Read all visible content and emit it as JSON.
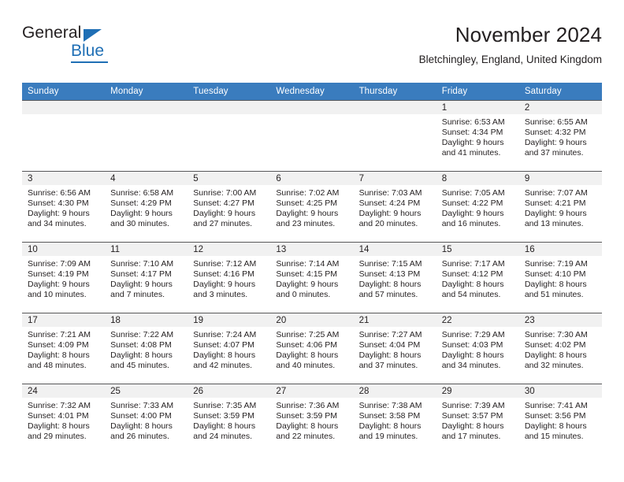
{
  "brand": {
    "word_one": "General",
    "word_two": "Blue"
  },
  "header": {
    "title": "November 2024",
    "subtitle": "Bletchingley, England, United Kingdom"
  },
  "colors": {
    "header_blue": "#3a7cbe",
    "brand_blue": "#1f6fb5",
    "daynum_band": "#f1f1f1",
    "text": "#231f20"
  },
  "weekdays": [
    "Sunday",
    "Monday",
    "Tuesday",
    "Wednesday",
    "Thursday",
    "Friday",
    "Saturday"
  ],
  "weeks": [
    [
      {
        "day": "",
        "empty": true,
        "sunrise": "",
        "sunset": "",
        "daylight1": "",
        "daylight2": ""
      },
      {
        "day": "",
        "empty": true,
        "sunrise": "",
        "sunset": "",
        "daylight1": "",
        "daylight2": ""
      },
      {
        "day": "",
        "empty": true,
        "sunrise": "",
        "sunset": "",
        "daylight1": "",
        "daylight2": ""
      },
      {
        "day": "",
        "empty": true,
        "sunrise": "",
        "sunset": "",
        "daylight1": "",
        "daylight2": ""
      },
      {
        "day": "",
        "empty": true,
        "sunrise": "",
        "sunset": "",
        "daylight1": "",
        "daylight2": ""
      },
      {
        "day": "1",
        "sunrise": "Sunrise: 6:53 AM",
        "sunset": "Sunset: 4:34 PM",
        "daylight1": "Daylight: 9 hours",
        "daylight2": "and 41 minutes."
      },
      {
        "day": "2",
        "sunrise": "Sunrise: 6:55 AM",
        "sunset": "Sunset: 4:32 PM",
        "daylight1": "Daylight: 9 hours",
        "daylight2": "and 37 minutes."
      }
    ],
    [
      {
        "day": "3",
        "sunrise": "Sunrise: 6:56 AM",
        "sunset": "Sunset: 4:30 PM",
        "daylight1": "Daylight: 9 hours",
        "daylight2": "and 34 minutes."
      },
      {
        "day": "4",
        "sunrise": "Sunrise: 6:58 AM",
        "sunset": "Sunset: 4:29 PM",
        "daylight1": "Daylight: 9 hours",
        "daylight2": "and 30 minutes."
      },
      {
        "day": "5",
        "sunrise": "Sunrise: 7:00 AM",
        "sunset": "Sunset: 4:27 PM",
        "daylight1": "Daylight: 9 hours",
        "daylight2": "and 27 minutes."
      },
      {
        "day": "6",
        "sunrise": "Sunrise: 7:02 AM",
        "sunset": "Sunset: 4:25 PM",
        "daylight1": "Daylight: 9 hours",
        "daylight2": "and 23 minutes."
      },
      {
        "day": "7",
        "sunrise": "Sunrise: 7:03 AM",
        "sunset": "Sunset: 4:24 PM",
        "daylight1": "Daylight: 9 hours",
        "daylight2": "and 20 minutes."
      },
      {
        "day": "8",
        "sunrise": "Sunrise: 7:05 AM",
        "sunset": "Sunset: 4:22 PM",
        "daylight1": "Daylight: 9 hours",
        "daylight2": "and 16 minutes."
      },
      {
        "day": "9",
        "sunrise": "Sunrise: 7:07 AM",
        "sunset": "Sunset: 4:21 PM",
        "daylight1": "Daylight: 9 hours",
        "daylight2": "and 13 minutes."
      }
    ],
    [
      {
        "day": "10",
        "sunrise": "Sunrise: 7:09 AM",
        "sunset": "Sunset: 4:19 PM",
        "daylight1": "Daylight: 9 hours",
        "daylight2": "and 10 minutes."
      },
      {
        "day": "11",
        "sunrise": "Sunrise: 7:10 AM",
        "sunset": "Sunset: 4:17 PM",
        "daylight1": "Daylight: 9 hours",
        "daylight2": "and 7 minutes."
      },
      {
        "day": "12",
        "sunrise": "Sunrise: 7:12 AM",
        "sunset": "Sunset: 4:16 PM",
        "daylight1": "Daylight: 9 hours",
        "daylight2": "and 3 minutes."
      },
      {
        "day": "13",
        "sunrise": "Sunrise: 7:14 AM",
        "sunset": "Sunset: 4:15 PM",
        "daylight1": "Daylight: 9 hours",
        "daylight2": "and 0 minutes."
      },
      {
        "day": "14",
        "sunrise": "Sunrise: 7:15 AM",
        "sunset": "Sunset: 4:13 PM",
        "daylight1": "Daylight: 8 hours",
        "daylight2": "and 57 minutes."
      },
      {
        "day": "15",
        "sunrise": "Sunrise: 7:17 AM",
        "sunset": "Sunset: 4:12 PM",
        "daylight1": "Daylight: 8 hours",
        "daylight2": "and 54 minutes."
      },
      {
        "day": "16",
        "sunrise": "Sunrise: 7:19 AM",
        "sunset": "Sunset: 4:10 PM",
        "daylight1": "Daylight: 8 hours",
        "daylight2": "and 51 minutes."
      }
    ],
    [
      {
        "day": "17",
        "sunrise": "Sunrise: 7:21 AM",
        "sunset": "Sunset: 4:09 PM",
        "daylight1": "Daylight: 8 hours",
        "daylight2": "and 48 minutes."
      },
      {
        "day": "18",
        "sunrise": "Sunrise: 7:22 AM",
        "sunset": "Sunset: 4:08 PM",
        "daylight1": "Daylight: 8 hours",
        "daylight2": "and 45 minutes."
      },
      {
        "day": "19",
        "sunrise": "Sunrise: 7:24 AM",
        "sunset": "Sunset: 4:07 PM",
        "daylight1": "Daylight: 8 hours",
        "daylight2": "and 42 minutes."
      },
      {
        "day": "20",
        "sunrise": "Sunrise: 7:25 AM",
        "sunset": "Sunset: 4:06 PM",
        "daylight1": "Daylight: 8 hours",
        "daylight2": "and 40 minutes."
      },
      {
        "day": "21",
        "sunrise": "Sunrise: 7:27 AM",
        "sunset": "Sunset: 4:04 PM",
        "daylight1": "Daylight: 8 hours",
        "daylight2": "and 37 minutes."
      },
      {
        "day": "22",
        "sunrise": "Sunrise: 7:29 AM",
        "sunset": "Sunset: 4:03 PM",
        "daylight1": "Daylight: 8 hours",
        "daylight2": "and 34 minutes."
      },
      {
        "day": "23",
        "sunrise": "Sunrise: 7:30 AM",
        "sunset": "Sunset: 4:02 PM",
        "daylight1": "Daylight: 8 hours",
        "daylight2": "and 32 minutes."
      }
    ],
    [
      {
        "day": "24",
        "sunrise": "Sunrise: 7:32 AM",
        "sunset": "Sunset: 4:01 PM",
        "daylight1": "Daylight: 8 hours",
        "daylight2": "and 29 minutes."
      },
      {
        "day": "25",
        "sunrise": "Sunrise: 7:33 AM",
        "sunset": "Sunset: 4:00 PM",
        "daylight1": "Daylight: 8 hours",
        "daylight2": "and 26 minutes."
      },
      {
        "day": "26",
        "sunrise": "Sunrise: 7:35 AM",
        "sunset": "Sunset: 3:59 PM",
        "daylight1": "Daylight: 8 hours",
        "daylight2": "and 24 minutes."
      },
      {
        "day": "27",
        "sunrise": "Sunrise: 7:36 AM",
        "sunset": "Sunset: 3:59 PM",
        "daylight1": "Daylight: 8 hours",
        "daylight2": "and 22 minutes."
      },
      {
        "day": "28",
        "sunrise": "Sunrise: 7:38 AM",
        "sunset": "Sunset: 3:58 PM",
        "daylight1": "Daylight: 8 hours",
        "daylight2": "and 19 minutes."
      },
      {
        "day": "29",
        "sunrise": "Sunrise: 7:39 AM",
        "sunset": "Sunset: 3:57 PM",
        "daylight1": "Daylight: 8 hours",
        "daylight2": "and 17 minutes."
      },
      {
        "day": "30",
        "sunrise": "Sunrise: 7:41 AM",
        "sunset": "Sunset: 3:56 PM",
        "daylight1": "Daylight: 8 hours",
        "daylight2": "and 15 minutes."
      }
    ]
  ]
}
